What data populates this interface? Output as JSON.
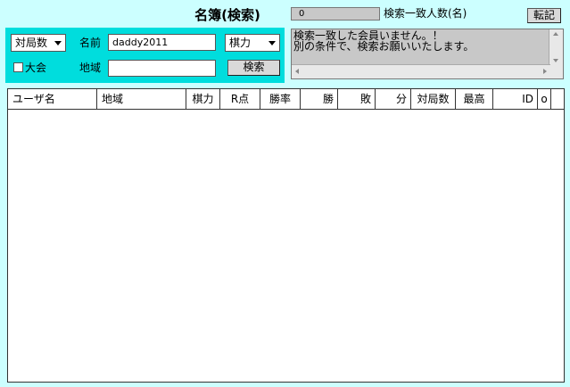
{
  "header": {
    "title": "名簿(検索)"
  },
  "search": {
    "sort_select": "対局数",
    "name_label": "名前",
    "name_value": "daddy2011",
    "rating_select": "棋力",
    "tournament_label": "大会",
    "region_label": "地域",
    "region_value": "",
    "search_button": "検索"
  },
  "results": {
    "count": "0",
    "count_label": "検索一致人数(名)",
    "transfer_button": "転記",
    "message": "検索一致した会員いません。！\n別の条件で、検索お願いいたします。"
  },
  "table": {
    "columns": [
      "ユーザ名",
      "地域",
      "棋力",
      "R点",
      "勝率",
      "勝",
      "敗",
      "分",
      "対局数",
      "最高",
      "ID",
      "o"
    ],
    "rows": []
  }
}
